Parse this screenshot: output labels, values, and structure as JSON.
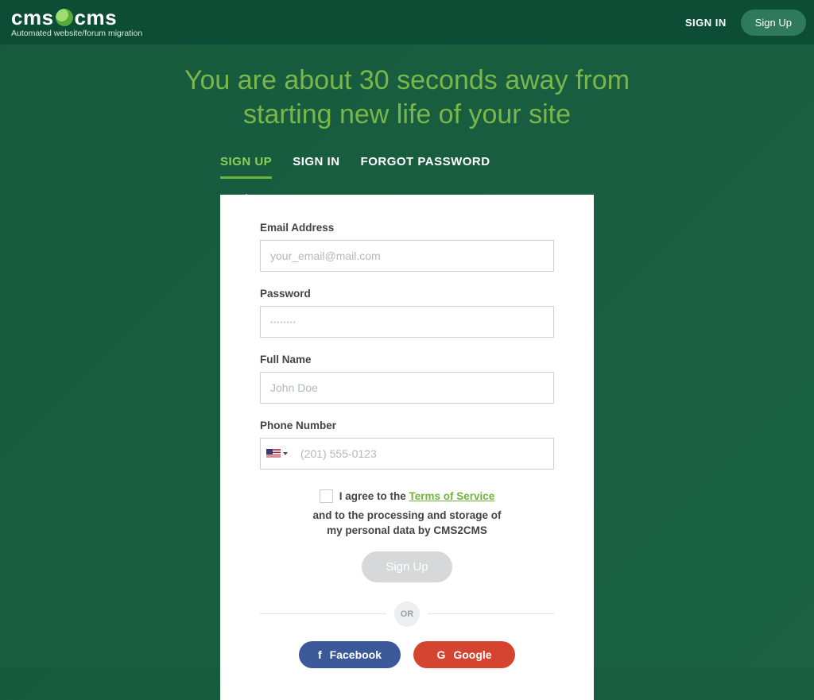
{
  "header": {
    "logo_left": "cms",
    "logo_right": "cms",
    "tagline": "Automated website/forum migration",
    "signin": "SIGN IN",
    "signup": "Sign Up"
  },
  "hero": {
    "line1": "You are about 30 seconds away from",
    "line2": "starting new life of your site"
  },
  "tabs": {
    "signup": "SIGN UP",
    "signin": "SIGN IN",
    "forgot": "FORGOT PASSWORD"
  },
  "form": {
    "email_label": "Email Address",
    "email_placeholder": "your_email@mail.com",
    "password_label": "Password",
    "password_placeholder": "********",
    "fullname_label": "Full Name",
    "fullname_placeholder": "John Doe",
    "phone_label": "Phone Number",
    "phone_placeholder": "(201) 555-0123",
    "consent_prefix": "I agree to the ",
    "consent_tos": "Terms of Service",
    "consent_line2": "and to the processing and storage of",
    "consent_line3": "my personal data by CMS2CMS",
    "submit": "Sign Up",
    "or": "OR",
    "facebook": "Facebook",
    "google": "Google"
  }
}
